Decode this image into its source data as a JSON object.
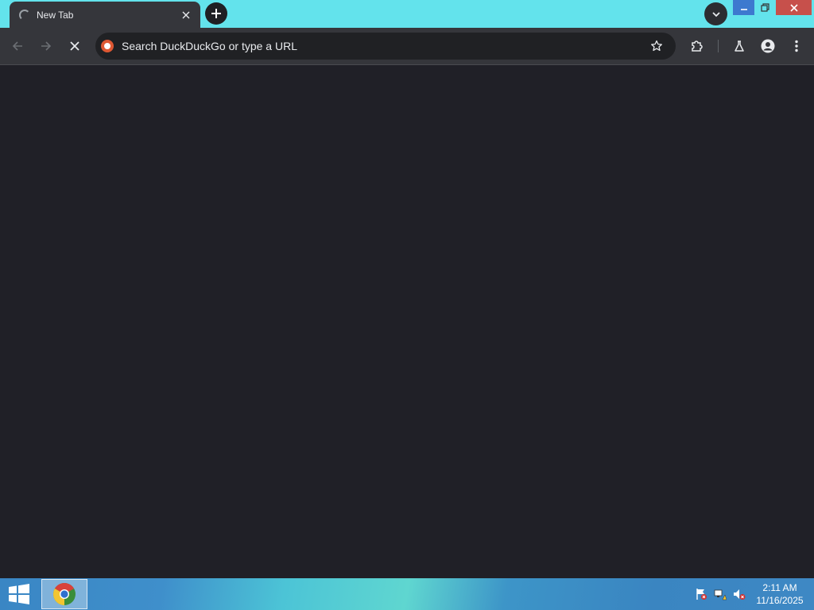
{
  "tab": {
    "title": "New Tab",
    "loading": true
  },
  "omnibox": {
    "placeholder": "Search DuckDuckGo or type a URL"
  },
  "icons": {
    "tab_spinner": "loading-spinner-icon",
    "tab_close": "close-icon",
    "new_tab": "plus-icon",
    "tab_search": "chevron-down-icon",
    "back": "arrow-left-icon",
    "forward": "arrow-right-icon",
    "stop": "close-icon",
    "search_engine": "duckduckgo-icon",
    "bookmark": "star-icon",
    "extensions": "puzzle-icon",
    "labs": "flask-icon",
    "profile": "person-icon",
    "menu": "kebab-menu-icon",
    "start": "windows-logo-icon",
    "taskbar_app": "chrome-icon",
    "tray_flag": "action-center-flag-icon",
    "tray_network": "network-icon",
    "tray_volume": "volume-muted-icon"
  },
  "colors": {
    "titlebar": "#63e3ec",
    "toolbar": "#35363b",
    "content": "#202027",
    "close_button": "#c7504b",
    "minimize_button": "#3d79cf"
  },
  "taskbar": {
    "clock": {
      "time": "2:11 AM",
      "date": "11/16/2025"
    }
  }
}
